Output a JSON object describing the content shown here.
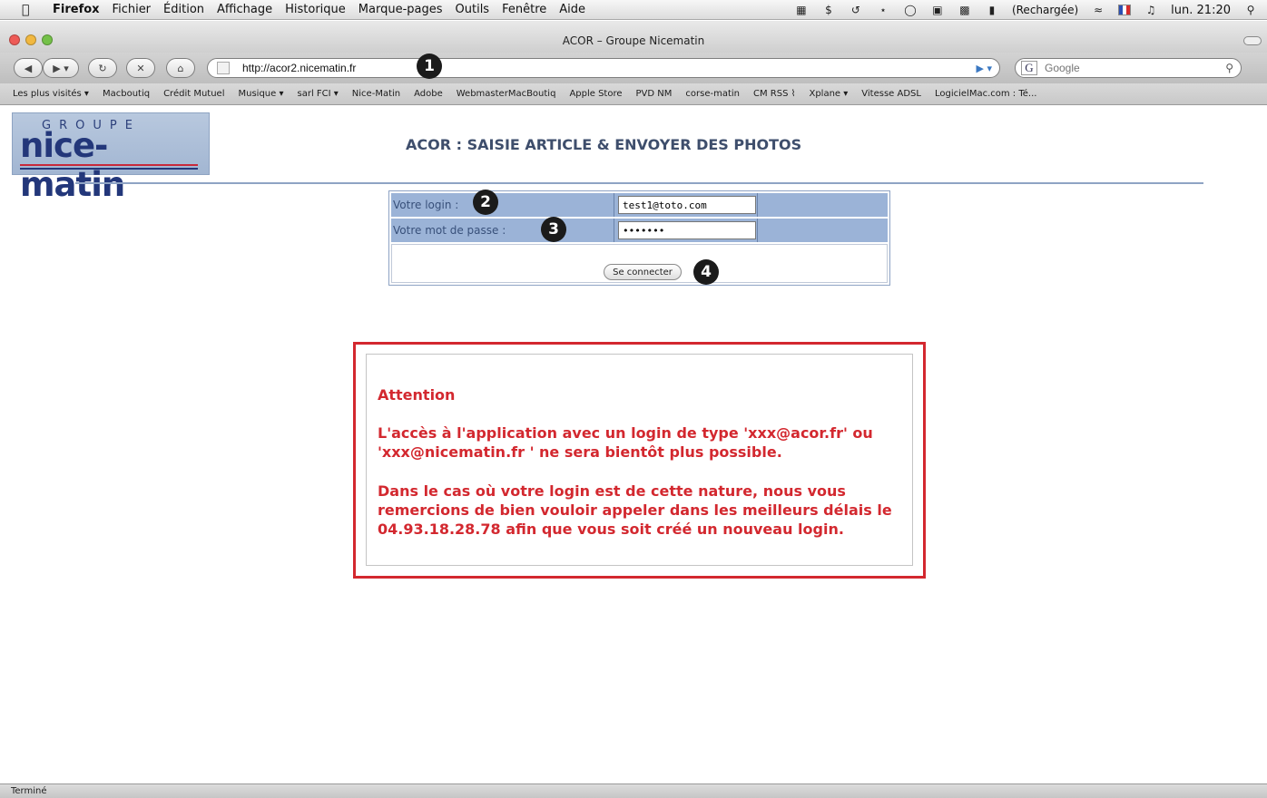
{
  "menubar": {
    "app": "Firefox",
    "items": [
      "Fichier",
      "Édition",
      "Affichage",
      "Historique",
      "Marque-pages",
      "Outils",
      "Fenêtre",
      "Aide"
    ],
    "battery": "(Rechargée)",
    "clock": "lun. 21:20"
  },
  "window": {
    "title": "ACOR – Groupe Nicematin"
  },
  "toolbar": {
    "url": "http://acor2.nicematin.fr",
    "search_placeholder": "Google",
    "search_engine": "G"
  },
  "callouts": [
    "1",
    "2",
    "3",
    "4"
  ],
  "bookmarks": [
    "Les plus visités ▾",
    "Macboutiq",
    "Crédit Mutuel",
    "Musique ▾",
    "sarl FCI ▾",
    "Nice-Matin",
    "Adobe",
    "WebmasterMacBoutiq",
    "Apple Store",
    "PVD NM",
    "corse-matin",
    "CM RSS ⌇",
    "Xplane ▾",
    "Vitesse ADSL",
    "LogicielMac.com : Té..."
  ],
  "logo": {
    "groupe": "GROUPE",
    "word": "nice-matin"
  },
  "page": {
    "title": "ACOR : SAISIE ARTICLE & ENVOYER DES PHOTOS",
    "login_label": "Votre login :",
    "login_value": "test1@toto.com",
    "password_label": "Votre mot de passe :",
    "password_value": "•••••••",
    "connect_button": "Se connecter"
  },
  "alert": {
    "heading": "Attention",
    "p1": "L'accès à l'application avec un login de type 'xxx@acor.fr' ou 'xxx@nicematin.fr ' ne sera bientôt plus possible.",
    "p2": "Dans le cas où votre login est de cette nature, nous vous remercions de bien vouloir appeler dans les meilleurs délais le 04.93.18.28.78 afin que vous soit créé un nouveau login."
  },
  "status": "Terminé",
  "colors": {
    "alert_red": "#d3282f",
    "form_blue": "#9bb3d7",
    "title_color": "#3e4e6c"
  }
}
